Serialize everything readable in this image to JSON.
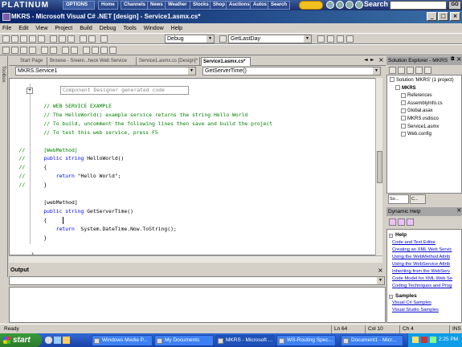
{
  "platinum_bar": {
    "logo": "PLATINUM",
    "options": "OPTIONS",
    "buttons": [
      "Home",
      "Channels",
      "News",
      "Weather",
      "Stocks",
      "Shop",
      "Auctions",
      "Autos",
      "Search"
    ],
    "search_label": "Search",
    "go": "GO"
  },
  "title_bar": {
    "title": "MKRS - Microsoft Visual C# .NET [design] - Service1.asmx.cs*"
  },
  "menu": [
    "File",
    "Edit",
    "View",
    "Project",
    "Build",
    "Debug",
    "Tools",
    "Window",
    "Help"
  ],
  "toolbar": {
    "config": "Debug",
    "find": "GetLastDay"
  },
  "tabs": [
    "Start Page",
    "Browse - Sreeni...heck Web Service",
    "Service1.asmx.cs [Design]*",
    "Service1.asmx.cs*"
  ],
  "code_nav": {
    "class": "MKRS.Service1",
    "member": "GetServerTime()"
  },
  "code": {
    "region": "Component Designer generated code",
    "lines": [
      {
        "indent": "        ",
        "parts": [
          {
            "t": "cm",
            "v": "// WEB SERVICE EXAMPLE"
          }
        ]
      },
      {
        "indent": "        ",
        "parts": [
          {
            "t": "cm",
            "v": "// The HelloWorld() example service returns the string Hello World"
          }
        ]
      },
      {
        "indent": "        ",
        "parts": [
          {
            "t": "cm",
            "v": "// To build, uncomment the following lines then save and build the project"
          }
        ]
      },
      {
        "indent": "        ",
        "parts": [
          {
            "t": "cm",
            "v": "// To test this web service, press F5"
          }
        ]
      },
      {
        "indent": "",
        "parts": []
      },
      {
        "indent": "//      ",
        "parts": [
          {
            "t": "cm",
            "v": "[WebMethod]"
          }
        ],
        "prefix_cm": true
      },
      {
        "indent": "//      ",
        "parts": [
          {
            "t": "kw",
            "v": "public string"
          },
          {
            "t": "tx",
            "v": " HelloWorld()"
          }
        ],
        "prefix_cm": true
      },
      {
        "indent": "//      ",
        "parts": [
          {
            "t": "tx",
            "v": "{"
          }
        ],
        "prefix_cm": true
      },
      {
        "indent": "//          ",
        "parts": [
          {
            "t": "kw",
            "v": "return"
          },
          {
            "t": "tx",
            "v": " \"Hello World\";"
          }
        ],
        "prefix_cm": true
      },
      {
        "indent": "//      ",
        "parts": [
          {
            "t": "tx",
            "v": "}"
          }
        ],
        "prefix_cm": true
      },
      {
        "indent": "",
        "parts": []
      },
      {
        "indent": "        ",
        "parts": [
          {
            "t": "tx",
            "v": "[webMethod]"
          }
        ]
      },
      {
        "indent": "        ",
        "parts": [
          {
            "t": "kw",
            "v": "public string"
          },
          {
            "t": "tx",
            "v": " GetServerTime()"
          }
        ]
      },
      {
        "indent": "        ",
        "parts": [
          {
            "t": "tx",
            "v": "{"
          }
        ]
      },
      {
        "indent": "            ",
        "parts": [
          {
            "t": "kw",
            "v": "return"
          },
          {
            "t": "tx",
            "v": "  System.DateTime.Now.ToString();"
          }
        ]
      },
      {
        "indent": "        ",
        "parts": [
          {
            "t": "tx",
            "v": "}"
          }
        ]
      },
      {
        "indent": "",
        "parts": []
      },
      {
        "indent": "    ",
        "parts": [
          {
            "t": "tx",
            "v": "}"
          }
        ]
      },
      {
        "indent": "",
        "parts": [
          {
            "t": "tx",
            "v": "}"
          }
        ]
      }
    ]
  },
  "output": {
    "title": "Output"
  },
  "solution_explorer": {
    "title": "Solution Explorer - MKRS",
    "items": [
      {
        "label": "Solution 'MKRS' (1 project)",
        "level": 0
      },
      {
        "label": "MKRS",
        "level": 1,
        "bold": true
      },
      {
        "label": "References",
        "level": 2
      },
      {
        "label": "AssemblyInfo.cs",
        "level": 2
      },
      {
        "label": "Global.asax",
        "level": 2
      },
      {
        "label": "MKRS.vsdisco",
        "level": 2
      },
      {
        "label": "Service1.asmx",
        "level": 2
      },
      {
        "label": "Web.config",
        "level": 2
      }
    ],
    "tabs": [
      "So...",
      "C..."
    ]
  },
  "dynamic_help": {
    "title": "Dynamic Help",
    "help_heading": "Help",
    "help_links": [
      "Code and Text Editor",
      "Creating an XML Web Servic",
      "Using the WebMethod Attrib",
      "Using the WebService Attrib",
      "Inheriting from the WebServ",
      "Code Model for XML Web Se",
      "Coding Techniques and Prog"
    ],
    "samples_heading": "Samples",
    "sample_links": [
      "Visual C# Samples",
      "Visual Studio Samples"
    ]
  },
  "status": {
    "ready": "Ready",
    "ln": "Ln 64",
    "col": "Col 10",
    "ch": "Ch 4",
    "ins": "INS"
  },
  "taskbar": {
    "start": "start",
    "items": [
      "Windows Media P...",
      "My Documents",
      "MKRS - Microsoft ...",
      "WS-Routing Spec...",
      "Document1 - Micr..."
    ],
    "clock": "2:25 PM"
  }
}
